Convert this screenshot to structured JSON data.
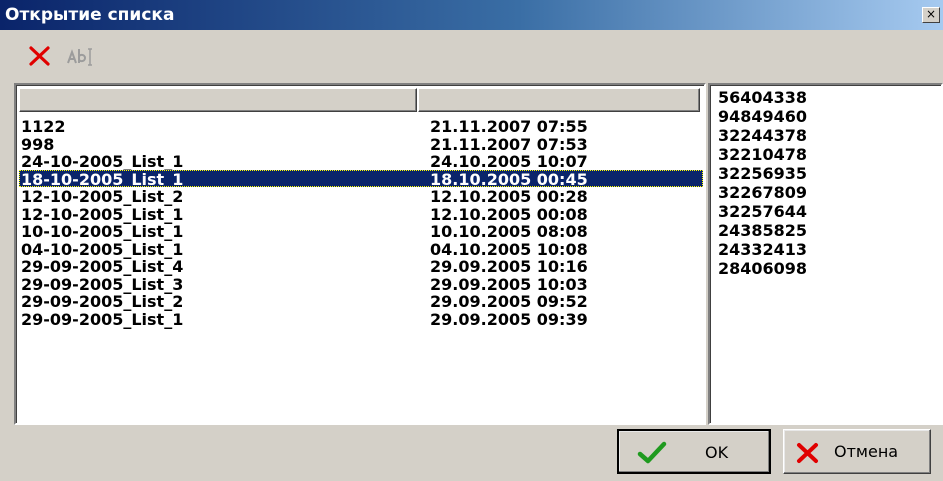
{
  "window": {
    "title": "Открытие списка",
    "close_glyph": "×"
  },
  "toolbar": {
    "delete_icon": "red-x-icon",
    "rename_icon": "rename-text-icon"
  },
  "list": {
    "columns": [
      "",
      ""
    ],
    "selected_index": 3,
    "rows": [
      {
        "name": "1122",
        "date": "21.11.2007 07:55"
      },
      {
        "name": "998",
        "date": "21.11.2007 07:53"
      },
      {
        "name": "24-10-2005_List_1",
        "date": "24.10.2005 10:07"
      },
      {
        "name": "18-10-2005_List_1",
        "date": "18.10.2005 00:45"
      },
      {
        "name": "12-10-2005_List_2",
        "date": "12.10.2005 00:28"
      },
      {
        "name": "12-10-2005_List_1",
        "date": "12.10.2005 00:08"
      },
      {
        "name": "10-10-2005_List_1",
        "date": "10.10.2005 08:08"
      },
      {
        "name": "04-10-2005_List_1",
        "date": "04.10.2005 10:08"
      },
      {
        "name": "29-09-2005_List_4",
        "date": "29.09.2005 10:16"
      },
      {
        "name": "29-09-2005_List_3",
        "date": "29.09.2005 10:03"
      },
      {
        "name": "29-09-2005_List_2",
        "date": "29.09.2005 09:52"
      },
      {
        "name": "29-09-2005_List_1",
        "date": "29.09.2005 09:39"
      }
    ]
  },
  "codes": [
    "56404338",
    "94849460",
    "32244378",
    "32210478",
    "32256935",
    "32267809",
    "32257644",
    "24385825",
    "24332413",
    "28406098"
  ],
  "buttons": {
    "ok_label": "OK",
    "cancel_label": "Отмена"
  },
  "colors": {
    "selection": "#0a246a",
    "titlebar": "#0a246a",
    "face": "#d4d0c8",
    "ok_icon": "#1f9a1f",
    "cancel_icon": "#e00000"
  }
}
